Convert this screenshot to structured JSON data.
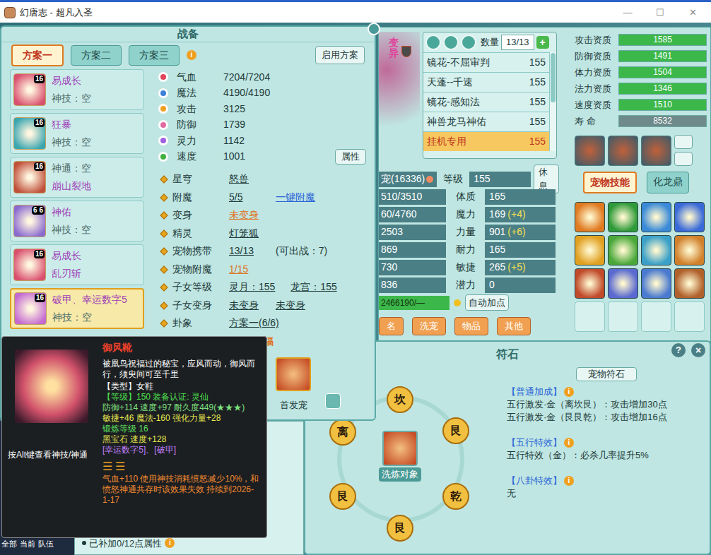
{
  "window": {
    "title": "幻唐志 - 超凡入圣",
    "controls": [
      "—",
      "☐",
      "✕"
    ]
  },
  "gear_panel": {
    "title": "战备",
    "tabs": [
      {
        "label": "方案一",
        "selected": true
      },
      {
        "label": "方案二",
        "selected": false
      },
      {
        "label": "方案三",
        "selected": false
      }
    ],
    "info": "i",
    "apply_button": "启用方案",
    "equipment": [
      {
        "badge": "16",
        "selected": false,
        "color": "#d9506e",
        "lines": [
          {
            "text": "易成长",
            "kind": "name"
          },
          {
            "text": "神技：空",
            "kind": "note"
          }
        ]
      },
      {
        "badge": "16",
        "selected": false,
        "color": "#3aa6b0",
        "lines": [
          {
            "text": "狂暴",
            "kind": "name"
          },
          {
            "text": "神技：空",
            "kind": "note"
          }
        ]
      },
      {
        "badge": "16",
        "selected": false,
        "color": "#c0503a",
        "lines": [
          {
            "text": "神通：空",
            "kind": "note"
          },
          {
            "text": "崩山裂地",
            "kind": "name"
          }
        ]
      },
      {
        "badge": "6 6",
        "selected": false,
        "color": "#8a6ad0",
        "lines": [
          {
            "text": "神佑",
            "kind": "name"
          },
          {
            "text": "神技：空",
            "kind": "note"
          }
        ]
      },
      {
        "badge": "16",
        "selected": false,
        "color": "#d9506e",
        "lines": [
          {
            "text": "易成长",
            "kind": "name"
          },
          {
            "text": "乱刃斩",
            "kind": "name"
          }
        ]
      },
      {
        "badge": "16",
        "selected": true,
        "color": "#c46ad0",
        "lines": [
          {
            "text": "破甲、幸运数字5",
            "kind": "name"
          },
          {
            "text": "神技：空",
            "kind": "note"
          }
        ]
      }
    ],
    "stats": [
      {
        "label": "气血",
        "value": "7204/7204",
        "color": "#e0455a"
      },
      {
        "label": "魔法",
        "value": "4190/4190",
        "color": "#3a7fd8"
      },
      {
        "label": "攻击",
        "value": "3125",
        "color": "#f0a020"
      },
      {
        "label": "防御",
        "value": "1739",
        "color": "#e06aa0"
      },
      {
        "label": "灵力",
        "value": "1142",
        "color": "#a060e0"
      },
      {
        "label": "速度",
        "value": "1001",
        "color": "#40b040"
      }
    ],
    "attr_button": "属性",
    "rows": [
      {
        "label": "星穹",
        "values": [
          {
            "text": "怒兽",
            "kind": "value"
          }
        ]
      },
      {
        "label": "附魔",
        "values": [
          {
            "text": "5/5",
            "kind": "value"
          },
          {
            "text": "一键附魔",
            "kind": "link"
          }
        ]
      },
      {
        "label": "变身",
        "values": [
          {
            "text": "未变身",
            "kind": "alert"
          }
        ]
      },
      {
        "label": "精灵",
        "values": [
          {
            "text": "灯笼狐",
            "kind": "value"
          }
        ]
      },
      {
        "label": "宠物携带",
        "values": [
          {
            "text": "13/13",
            "kind": "value"
          },
          {
            "text": "(可出战：7)",
            "kind": "plain"
          }
        ]
      },
      {
        "label": "宠物附魔",
        "values": [
          {
            "text": "1/15",
            "kind": "alert"
          }
        ]
      },
      {
        "label": "子女等级",
        "values": [
          {
            "text": "灵月：155",
            "kind": "value"
          },
          {
            "text": "龙宫：155",
            "kind": "value"
          }
        ]
      },
      {
        "label": "子女变身",
        "values": [
          {
            "text": "未变身",
            "kind": "value"
          },
          {
            "text": "未变身",
            "kind": "value"
          }
        ]
      },
      {
        "label": "卦象",
        "values": [
          {
            "text": "方案一(6/6)",
            "kind": "value"
          }
        ]
      }
    ],
    "fortune_button": "福",
    "first_pet": "首发宠"
  },
  "tooltip": {
    "name": "御风靴",
    "description": "被凰鸟祝福过的秘宝，应风而动，御风而行，须臾间可至千里",
    "lines": [
      {
        "text": "【类型】女鞋",
        "color": "#ffffff"
      },
      {
        "text": "【等级】150 装备认证: 灵仙",
        "color": "#4ee04e"
      },
      {
        "text": "防御+114 速度+97 耐久度449(★★★)",
        "color": "#7fe07f"
      },
      {
        "text": "敏捷+46 魔法-160 强化力量+28",
        "color": "#e8e850"
      },
      {
        "text": "锻炼等级 16",
        "color": "#5ee05e"
      },
      {
        "text": "黑宝石 速度+128",
        "color": "#e8e850"
      },
      {
        "text": "[幸运数字5]、[破甲]",
        "color": "#c080ff"
      }
    ],
    "trigram": "☰ ☰",
    "effect": "气血+110 使用神技消耗愤怒减少10%，和愤怒神通共存时该效果失效 持续到2026-1-17",
    "hint": "按Alt键查看神技/神通"
  },
  "pet_panel": {
    "mutation": "变异",
    "count_label": "数量",
    "count": "13/13",
    "add": "+",
    "pets": [
      {
        "name": "镜花-不屈审判",
        "level": "155",
        "selected": false
      },
      {
        "name": "天蓬--千速",
        "level": "155",
        "selected": false
      },
      {
        "name": "镜花-感知法",
        "level": "155",
        "selected": false
      },
      {
        "name": "神兽龙马神佑",
        "level": "155",
        "selected": false
      },
      {
        "name": "挂机专用",
        "level": "155",
        "selected": true
      }
    ],
    "aptitudes": [
      {
        "label": "攻击资质",
        "value": "1585",
        "level": 1,
        "color": "#3cb84a"
      },
      {
        "label": "防御资质",
        "value": "1491",
        "level": 1,
        "color": "#3cb84a"
      },
      {
        "label": "体力资质",
        "value": "1504",
        "level": 1,
        "color": "#3cb84a"
      },
      {
        "label": "法力资质",
        "value": "1346",
        "level": 1,
        "color": "#3cb84a"
      },
      {
        "label": "速度资质",
        "value": "1510",
        "level": 1,
        "color": "#3cb84a"
      },
      {
        "label": "寿 命",
        "value": "8532",
        "level": 1,
        "color": "#6f8a8a"
      }
    ],
    "tabs": [
      {
        "label": "宠物技能",
        "selected": true
      },
      {
        "label": "化龙鼎",
        "selected": false
      }
    ],
    "skills": [
      {
        "color": "#e07a20",
        "empty": false
      },
      {
        "color": "#2f9a3a",
        "empty": false
      },
      {
        "color": "#3a8ad8",
        "empty": false
      },
      {
        "color": "#3a6ad8",
        "empty": false
      },
      {
        "color": "#e0a020",
        "empty": false
      },
      {
        "color": "#4aa83a",
        "empty": false
      },
      {
        "color": "#3aa0c8",
        "empty": false
      },
      {
        "color": "#d0802a",
        "empty": false
      },
      {
        "color": "#c04a2a",
        "empty": false
      },
      {
        "color": "#5a6ad0",
        "empty": false
      },
      {
        "color": "#4a7ad0",
        "empty": false
      },
      {
        "color": "#b0602a",
        "empty": false
      },
      {
        "color": "#000000",
        "empty": true
      },
      {
        "color": "#000000",
        "empty": true
      },
      {
        "color": "#000000",
        "empty": true
      },
      {
        "color": "#000000",
        "empty": true
      }
    ],
    "stats": [
      {
        "left": "宠(16336)",
        "label": "等级",
        "value": "155",
        "bonus": ""
      },
      {
        "left": "510/3510",
        "label": "体质",
        "value": "165",
        "bonus": ""
      },
      {
        "left": "60/4760",
        "label": "魔力",
        "value": "169",
        "bonus": "(+4)"
      },
      {
        "left": "2503",
        "label": "力量",
        "value": "901",
        "bonus": "(+6)"
      },
      {
        "left": "869",
        "label": "耐力",
        "value": "165",
        "bonus": ""
      },
      {
        "left": "730",
        "label": "敏捷",
        "value": "265",
        "bonus": "(+5)"
      },
      {
        "left": "836",
        "label": "潜力",
        "value": "0",
        "bonus": ""
      }
    ],
    "rest_button": "休息",
    "exp": "2466190/—",
    "auto_button": "自动加点",
    "buttons": [
      "名",
      "洗宠",
      "物品",
      "其他"
    ]
  },
  "rune_panel": {
    "title": "符石",
    "help": "?",
    "close": "×",
    "tab": "宠物符石",
    "info": "i",
    "nodes": [
      {
        "label": "坎"
      },
      {
        "label": "离"
      },
      {
        "label": "艮"
      },
      {
        "label": "艮"
      },
      {
        "label": "乾"
      },
      {
        "label": "艮"
      }
    ],
    "center_label": "洗炼对象",
    "sections": [
      {
        "title": "【普通加成】",
        "lines": [
          "五行激发·金（离坎艮）：攻击增加30点",
          "五行激发·金（艮艮乾）：攻击增加16点"
        ]
      },
      {
        "title": "【五行特效】",
        "lines": [
          "五行特效（金）：必杀几率提升5%"
        ]
      },
      {
        "title": "【八卦特效】",
        "lines": [
          "无"
        ]
      }
    ]
  },
  "chat": {
    "tabs": [
      "全部",
      "当前",
      "队伍"
    ],
    "notes": [
      "已补加0/12点属性"
    ],
    "info": "i"
  }
}
